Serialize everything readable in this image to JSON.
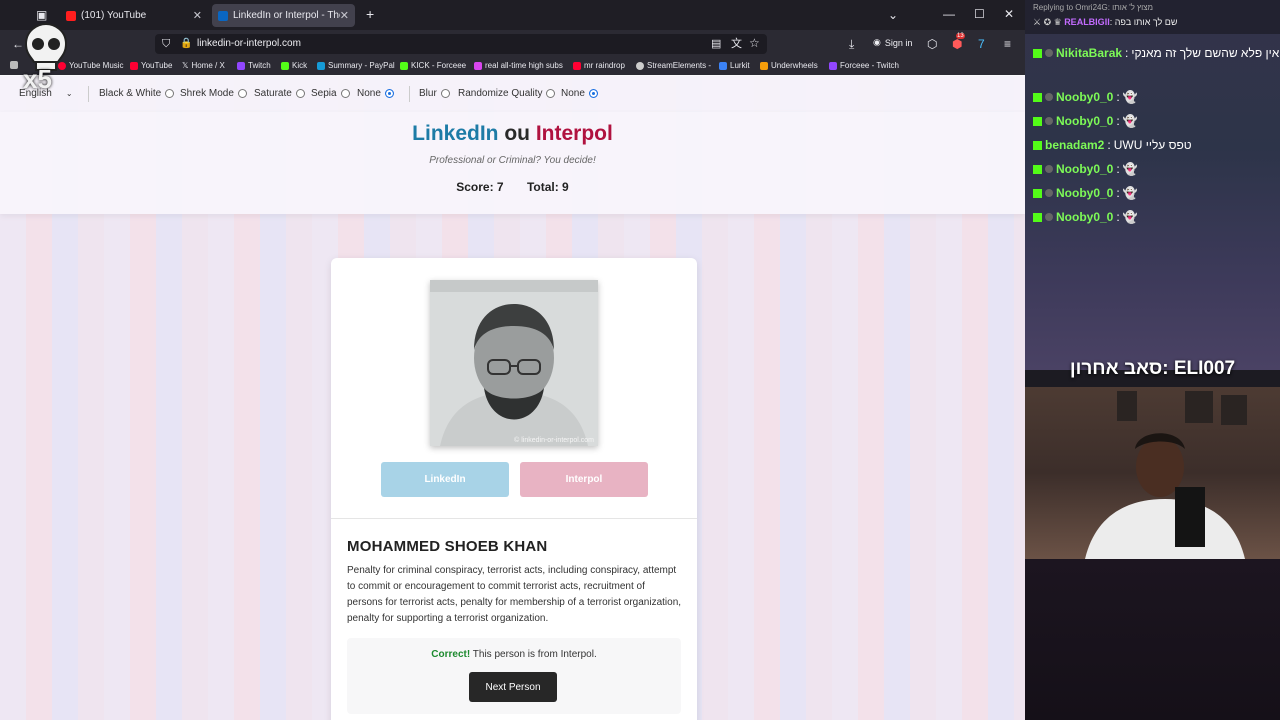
{
  "browser": {
    "tabs": [
      {
        "title": "(101) YouTube",
        "active": false
      },
      {
        "title": "LinkedIn or Interpol - The Game",
        "active": true
      }
    ],
    "url": "linkedin-or-interpol.com",
    "signin_label": "Sign in",
    "extension_badge": "13",
    "bookmarks": [
      {
        "label": "YouTube Music",
        "icon": "youtube-music-icon",
        "color": "#ff0033"
      },
      {
        "label": "YouTube",
        "icon": "youtube-icon",
        "color": "#ff0033"
      },
      {
        "label": "Home / X",
        "icon": "x-icon",
        "color": "#ffffff"
      },
      {
        "label": "Twitch",
        "icon": "twitch-icon",
        "color": "#9146ff"
      },
      {
        "label": "Kick",
        "icon": "kick-icon",
        "color": "#53fc18"
      },
      {
        "label": "Summary - PayPal",
        "icon": "paypal-icon",
        "color": "#169bd7"
      },
      {
        "label": "KICK - Forceee",
        "icon": "kick-icon",
        "color": "#53fc18"
      },
      {
        "label": "real all-time high subs",
        "icon": "chart-icon",
        "color": "#d946ef"
      },
      {
        "label": "mr raindrop",
        "icon": "youtube-icon",
        "color": "#ff0033"
      },
      {
        "label": "StreamElements -",
        "icon": "streamelements-icon",
        "color": "#cccccc"
      },
      {
        "label": "Lurkit",
        "icon": "lurkit-icon",
        "color": "#3b82f6"
      },
      {
        "label": "Underwheels",
        "icon": "underwheels-icon",
        "color": "#f59e0b"
      },
      {
        "label": "Forceee - Twitch",
        "icon": "twitch-icon",
        "color": "#9146ff"
      }
    ]
  },
  "controls": {
    "language": "English",
    "filters": [
      {
        "label": "Black & White",
        "checked": false
      },
      {
        "label": "Shrek Mode",
        "checked": false
      },
      {
        "label": "Saturate",
        "checked": false
      },
      {
        "label": "Sepia",
        "checked": false
      },
      {
        "label": "None",
        "checked": true
      }
    ],
    "quality": [
      {
        "label": "Blur",
        "checked": false
      },
      {
        "label": "Randomize Quality",
        "checked": false
      },
      {
        "label": "None",
        "checked": true
      }
    ]
  },
  "header": {
    "title_linkedin": "LinkedIn",
    "title_ou": "ou",
    "title_interpol": "Interpol",
    "subtitle": "Professional or Criminal? You decide!",
    "score_label": "Score: 7",
    "total_label": "Total: 9"
  },
  "card": {
    "watermark": "© linkedin-or-interpol.com",
    "linkedin_button": "LinkedIn",
    "interpol_button": "Interpol",
    "name": "MOHAMMED SHOEB KHAN",
    "description": "Penalty for criminal conspiracy, terrorist acts, including conspiracy, attempt to commit or encouragement to commit terrorist acts, recruitment of persons for terrorist acts, penalty for membership of a terrorist organization, penalty for supporting a terrorist organization.",
    "result_correct": "Correct!",
    "result_text": "This person is from Interpol.",
    "next_button": "Next Person"
  },
  "overlay": {
    "replying_to": "Replying to Omri24G: מצוץ ל' אותו",
    "pinned_user": "REALBIGII",
    "pinned_text": "שם לך אותו בפה",
    "messages": [
      {
        "user": "NikitaBarak",
        "text": "אין פלא שהשם שלך זה מאנקי"
      },
      {
        "user": "Nooby0_0",
        "text": "👻"
      },
      {
        "user": "Nooby0_0",
        "text": "👻"
      },
      {
        "user": "benadam2",
        "text": "UWU טפס עליי"
      },
      {
        "user": "Nooby0_0",
        "text": "👻"
      },
      {
        "user": "Nooby0_0",
        "text": "👻"
      },
      {
        "user": "Nooby0_0",
        "text": "👻"
      }
    ],
    "last_sub": "סאב אחרון: ELI007",
    "multiplier": "x5"
  },
  "colors": {
    "linkedin": "#1d7ba6",
    "interpol": "#b0123f",
    "correct": "#1c8a2e",
    "kick_green": "#53fc18"
  }
}
